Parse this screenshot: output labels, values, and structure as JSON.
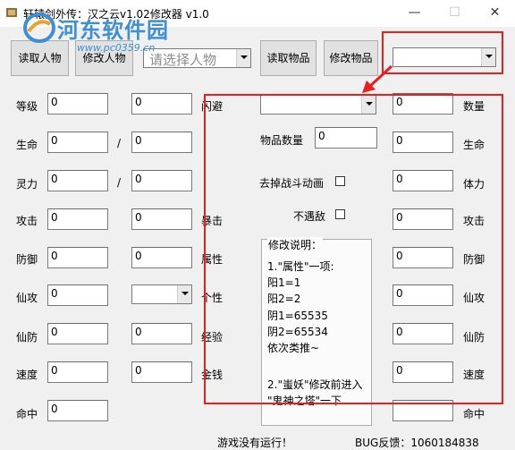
{
  "window": {
    "title": "轩辕剑外传：汉之云v1.02修改器 v1.0",
    "minimize": "—",
    "maximize": "☐",
    "close": "✕"
  },
  "watermark": {
    "brand": "河东软件园",
    "url": "www.pc0359.cn"
  },
  "toolbar": {
    "read_person": "读取人物",
    "modify_person": "修改人物",
    "person_select_placeholder": "请选择人物",
    "read_item": "读取物品",
    "modify_item": "修改物品",
    "item_select_value": ""
  },
  "left_stats": [
    {
      "label": "等级",
      "value1": "0",
      "value2": "0"
    },
    {
      "label": "生命",
      "value1": "0",
      "sep": "/",
      "value2": "0"
    },
    {
      "label": "灵力",
      "value1": "0",
      "sep": "/",
      "value2": "0"
    },
    {
      "label": "攻击",
      "value1": "0",
      "value2": "0"
    },
    {
      "label": "防御",
      "value1": "0",
      "value2": "0"
    },
    {
      "label": "仙攻",
      "value1": "0"
    },
    {
      "label": "仙防",
      "value1": "0",
      "value2": "0"
    },
    {
      "label": "速度",
      "value1": "0",
      "value2": "0"
    },
    {
      "label": "命中",
      "value1": "0"
    }
  ],
  "mid_labels": [
    "闪避",
    "暴击",
    "属性",
    "个性",
    "经验",
    "金钱"
  ],
  "item_panel": {
    "item_count_label": "物品数量",
    "item_count_value": "0",
    "remove_anim_label": "去掉战斗动画",
    "no_encounter_label": "不遇敌",
    "note_title": "修改说明：",
    "note_lines": [
      "1.\"属性\"一项:",
      "阳1=1",
      "阳2=2",
      "阴1=65535",
      "阴2=65534",
      "依次类推~",
      "",
      "2.\"蚩妖\"修改前进入",
      "\"鬼神之塔\"一下"
    ]
  },
  "right_stats": [
    {
      "label": "数量",
      "value": "0"
    },
    {
      "label": "生命",
      "value": "0"
    },
    {
      "label": "体力",
      "value": "0"
    },
    {
      "label": "攻击",
      "value": "0"
    },
    {
      "label": "防御",
      "value": "0"
    },
    {
      "label": "仙攻",
      "value": "0"
    },
    {
      "label": "仙防",
      "value": "0"
    },
    {
      "label": "速度",
      "value": "0"
    },
    {
      "label": "命中",
      "value": ""
    }
  ],
  "status": {
    "game_status": "游戏没有运行！",
    "bug_report": "BUG反馈：1060184838"
  },
  "colors": {
    "highlight": "#e81f1f",
    "brand": "#3f8fd2"
  }
}
